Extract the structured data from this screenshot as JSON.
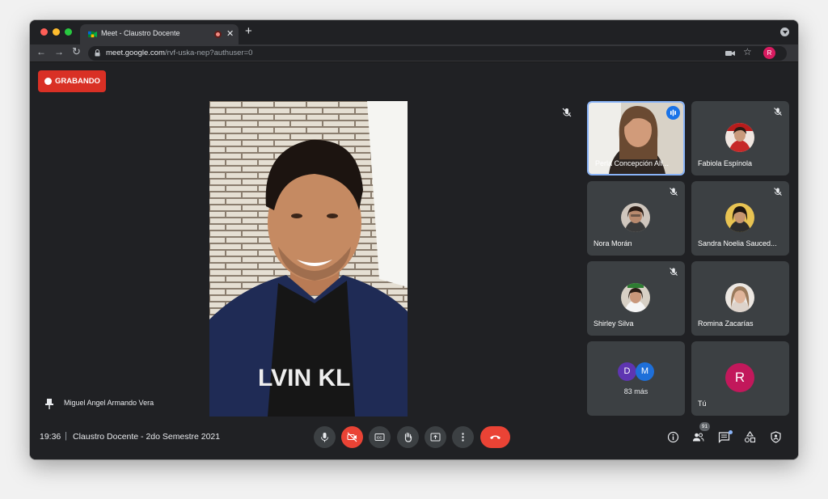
{
  "browser": {
    "tab_title": "Meet - Claustro Docente -",
    "tab_close": "✕",
    "new_tab": "+",
    "url_host": "meet.google.com",
    "url_path": "/rvf-uska-nep?authuser=0",
    "profile_initial": "R"
  },
  "meet": {
    "recording_label": "GRABANDO",
    "main_speaker_name": "Miguel Angel Armando Vera",
    "main_shirt_text": "LVIN KL",
    "time": "19:36",
    "separator": "|",
    "meeting_title": "Claustro Docente - 2do Semestre 2021",
    "participants_count": "91"
  },
  "tiles": [
    {
      "name": "Perla Concepción Alf...",
      "speaking": true
    },
    {
      "name": "Fabiola Espínola",
      "muted": true
    },
    {
      "name": "Nora Morán",
      "muted": true
    },
    {
      "name": "Sandra Noelia Sauced...",
      "muted": true
    },
    {
      "name": "Shirley Silva",
      "muted": true
    },
    {
      "name": "Romina Zacarías",
      "muted": true
    },
    {
      "name": "83 más",
      "initials": [
        "D",
        "M"
      ]
    },
    {
      "name": "Tú",
      "initial": "R"
    }
  ],
  "colors": {
    "recording": "#d93025",
    "hangup": "#ea4335",
    "active_border": "#8ab4f8",
    "tile_bg": "#3c4043",
    "avatar_d": "#5e35b1",
    "avatar_m": "#1e6fd9",
    "avatar_r": "#c2185b"
  },
  "icons": {
    "controls": [
      "mic-icon",
      "camera-off-icon",
      "captions-icon",
      "raise-hand-icon",
      "present-icon",
      "more-options-icon",
      "hangup-icon"
    ],
    "right": [
      "info-icon",
      "people-icon",
      "chat-icon",
      "activities-icon",
      "host-controls-icon"
    ]
  }
}
